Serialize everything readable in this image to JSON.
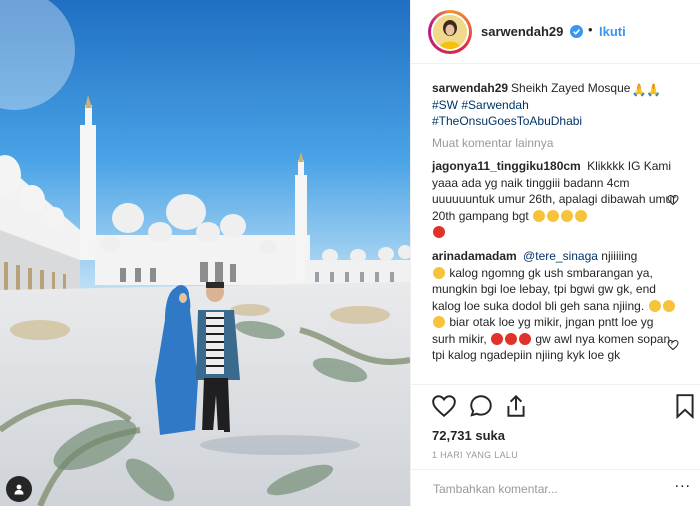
{
  "header": {
    "username": "sarwendah29",
    "separator": "•",
    "follow_label": "Ikuti"
  },
  "caption": {
    "username": "sarwendah29",
    "text": "Sheikh Zayed Mosque",
    "hashtags": [
      "#SW",
      "#Sarwendah",
      "#TheOnsuGoesToAbuDhabi"
    ]
  },
  "more_comments_label": "Muat komentar lainnya",
  "comments": [
    {
      "username": "jagonya11_tinggiku180cm",
      "text": "Klikkkk IG Kami yaaa ada yg naik tinggiii badann 4cm uuuuuuntuk umur 26th, apalagi dibawah umur 20th gampang bgt"
    },
    {
      "username": "arinadamadam",
      "mention": "@tere_sinaga",
      "text_1": "njiiiiing",
      "text_2": "kalog ngomng gk ush smbarangan ya, mungkin bgi loe lebay, tpi bgwi gw gk, end kalog loe suka dodol bli geh sana njiing.",
      "text_3": "biar otak loe yg mikir, jngan pntt loe yg surh mikir,",
      "text_4": "gw awl nya komen sopan, tpi kalog ngadepiin njiing kyk loe gk"
    }
  ],
  "likes": "72,731 suka",
  "timestamp": "1 HARI YANG LALU",
  "comment_input": {
    "placeholder": "Tambahkan komentar...",
    "value": ""
  },
  "more_options": "...",
  "colors": {
    "link": "#3897f0",
    "hashtag": "#003569",
    "muted": "#999999",
    "text": "#262626",
    "verified": "#3897f0"
  },
  "icons": [
    "verified-badge-icon",
    "heart-icon",
    "comment-icon",
    "share-icon",
    "bookmark-icon",
    "user-tag-icon",
    "pray-emoji-icon"
  ]
}
